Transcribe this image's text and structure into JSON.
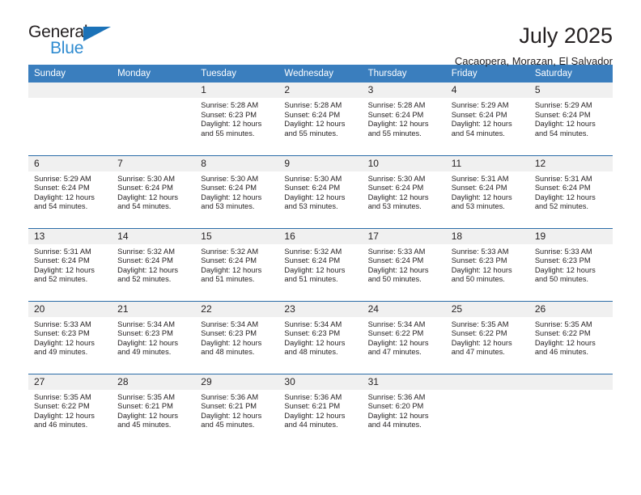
{
  "brand": {
    "name_top": "General",
    "name_bottom": "Blue",
    "accent_color": "#2e8bd0",
    "triangle_color": "#1b72b8"
  },
  "header": {
    "month_title": "July 2025",
    "location": "Cacaopera, Morazan, El Salvador"
  },
  "calendar": {
    "header_bg": "#3a7ebe",
    "daynum_bg": "#f0f0f0",
    "row_border": "#2b6ca8",
    "weekday_headers": [
      "Sunday",
      "Monday",
      "Tuesday",
      "Wednesday",
      "Thursday",
      "Friday",
      "Saturday"
    ],
    "weeks": [
      [
        {
          "day": ""
        },
        {
          "day": ""
        },
        {
          "day": "1",
          "sunrise": "Sunrise: 5:28 AM",
          "sunset": "Sunset: 6:23 PM",
          "daylight_1": "Daylight: 12 hours",
          "daylight_2": "and 55 minutes."
        },
        {
          "day": "2",
          "sunrise": "Sunrise: 5:28 AM",
          "sunset": "Sunset: 6:24 PM",
          "daylight_1": "Daylight: 12 hours",
          "daylight_2": "and 55 minutes."
        },
        {
          "day": "3",
          "sunrise": "Sunrise: 5:28 AM",
          "sunset": "Sunset: 6:24 PM",
          "daylight_1": "Daylight: 12 hours",
          "daylight_2": "and 55 minutes."
        },
        {
          "day": "4",
          "sunrise": "Sunrise: 5:29 AM",
          "sunset": "Sunset: 6:24 PM",
          "daylight_1": "Daylight: 12 hours",
          "daylight_2": "and 54 minutes."
        },
        {
          "day": "5",
          "sunrise": "Sunrise: 5:29 AM",
          "sunset": "Sunset: 6:24 PM",
          "daylight_1": "Daylight: 12 hours",
          "daylight_2": "and 54 minutes."
        }
      ],
      [
        {
          "day": "6",
          "sunrise": "Sunrise: 5:29 AM",
          "sunset": "Sunset: 6:24 PM",
          "daylight_1": "Daylight: 12 hours",
          "daylight_2": "and 54 minutes."
        },
        {
          "day": "7",
          "sunrise": "Sunrise: 5:30 AM",
          "sunset": "Sunset: 6:24 PM",
          "daylight_1": "Daylight: 12 hours",
          "daylight_2": "and 54 minutes."
        },
        {
          "day": "8",
          "sunrise": "Sunrise: 5:30 AM",
          "sunset": "Sunset: 6:24 PM",
          "daylight_1": "Daylight: 12 hours",
          "daylight_2": "and 53 minutes."
        },
        {
          "day": "9",
          "sunrise": "Sunrise: 5:30 AM",
          "sunset": "Sunset: 6:24 PM",
          "daylight_1": "Daylight: 12 hours",
          "daylight_2": "and 53 minutes."
        },
        {
          "day": "10",
          "sunrise": "Sunrise: 5:30 AM",
          "sunset": "Sunset: 6:24 PM",
          "daylight_1": "Daylight: 12 hours",
          "daylight_2": "and 53 minutes."
        },
        {
          "day": "11",
          "sunrise": "Sunrise: 5:31 AM",
          "sunset": "Sunset: 6:24 PM",
          "daylight_1": "Daylight: 12 hours",
          "daylight_2": "and 53 minutes."
        },
        {
          "day": "12",
          "sunrise": "Sunrise: 5:31 AM",
          "sunset": "Sunset: 6:24 PM",
          "daylight_1": "Daylight: 12 hours",
          "daylight_2": "and 52 minutes."
        }
      ],
      [
        {
          "day": "13",
          "sunrise": "Sunrise: 5:31 AM",
          "sunset": "Sunset: 6:24 PM",
          "daylight_1": "Daylight: 12 hours",
          "daylight_2": "and 52 minutes."
        },
        {
          "day": "14",
          "sunrise": "Sunrise: 5:32 AM",
          "sunset": "Sunset: 6:24 PM",
          "daylight_1": "Daylight: 12 hours",
          "daylight_2": "and 52 minutes."
        },
        {
          "day": "15",
          "sunrise": "Sunrise: 5:32 AM",
          "sunset": "Sunset: 6:24 PM",
          "daylight_1": "Daylight: 12 hours",
          "daylight_2": "and 51 minutes."
        },
        {
          "day": "16",
          "sunrise": "Sunrise: 5:32 AM",
          "sunset": "Sunset: 6:24 PM",
          "daylight_1": "Daylight: 12 hours",
          "daylight_2": "and 51 minutes."
        },
        {
          "day": "17",
          "sunrise": "Sunrise: 5:33 AM",
          "sunset": "Sunset: 6:24 PM",
          "daylight_1": "Daylight: 12 hours",
          "daylight_2": "and 50 minutes."
        },
        {
          "day": "18",
          "sunrise": "Sunrise: 5:33 AM",
          "sunset": "Sunset: 6:23 PM",
          "daylight_1": "Daylight: 12 hours",
          "daylight_2": "and 50 minutes."
        },
        {
          "day": "19",
          "sunrise": "Sunrise: 5:33 AM",
          "sunset": "Sunset: 6:23 PM",
          "daylight_1": "Daylight: 12 hours",
          "daylight_2": "and 50 minutes."
        }
      ],
      [
        {
          "day": "20",
          "sunrise": "Sunrise: 5:33 AM",
          "sunset": "Sunset: 6:23 PM",
          "daylight_1": "Daylight: 12 hours",
          "daylight_2": "and 49 minutes."
        },
        {
          "day": "21",
          "sunrise": "Sunrise: 5:34 AM",
          "sunset": "Sunset: 6:23 PM",
          "daylight_1": "Daylight: 12 hours",
          "daylight_2": "and 49 minutes."
        },
        {
          "day": "22",
          "sunrise": "Sunrise: 5:34 AM",
          "sunset": "Sunset: 6:23 PM",
          "daylight_1": "Daylight: 12 hours",
          "daylight_2": "and 48 minutes."
        },
        {
          "day": "23",
          "sunrise": "Sunrise: 5:34 AM",
          "sunset": "Sunset: 6:23 PM",
          "daylight_1": "Daylight: 12 hours",
          "daylight_2": "and 48 minutes."
        },
        {
          "day": "24",
          "sunrise": "Sunrise: 5:34 AM",
          "sunset": "Sunset: 6:22 PM",
          "daylight_1": "Daylight: 12 hours",
          "daylight_2": "and 47 minutes."
        },
        {
          "day": "25",
          "sunrise": "Sunrise: 5:35 AM",
          "sunset": "Sunset: 6:22 PM",
          "daylight_1": "Daylight: 12 hours",
          "daylight_2": "and 47 minutes."
        },
        {
          "day": "26",
          "sunrise": "Sunrise: 5:35 AM",
          "sunset": "Sunset: 6:22 PM",
          "daylight_1": "Daylight: 12 hours",
          "daylight_2": "and 46 minutes."
        }
      ],
      [
        {
          "day": "27",
          "sunrise": "Sunrise: 5:35 AM",
          "sunset": "Sunset: 6:22 PM",
          "daylight_1": "Daylight: 12 hours",
          "daylight_2": "and 46 minutes."
        },
        {
          "day": "28",
          "sunrise": "Sunrise: 5:35 AM",
          "sunset": "Sunset: 6:21 PM",
          "daylight_1": "Daylight: 12 hours",
          "daylight_2": "and 45 minutes."
        },
        {
          "day": "29",
          "sunrise": "Sunrise: 5:36 AM",
          "sunset": "Sunset: 6:21 PM",
          "daylight_1": "Daylight: 12 hours",
          "daylight_2": "and 45 minutes."
        },
        {
          "day": "30",
          "sunrise": "Sunrise: 5:36 AM",
          "sunset": "Sunset: 6:21 PM",
          "daylight_1": "Daylight: 12 hours",
          "daylight_2": "and 44 minutes."
        },
        {
          "day": "31",
          "sunrise": "Sunrise: 5:36 AM",
          "sunset": "Sunset: 6:20 PM",
          "daylight_1": "Daylight: 12 hours",
          "daylight_2": "and 44 minutes."
        },
        {
          "day": ""
        },
        {
          "day": ""
        }
      ]
    ]
  }
}
